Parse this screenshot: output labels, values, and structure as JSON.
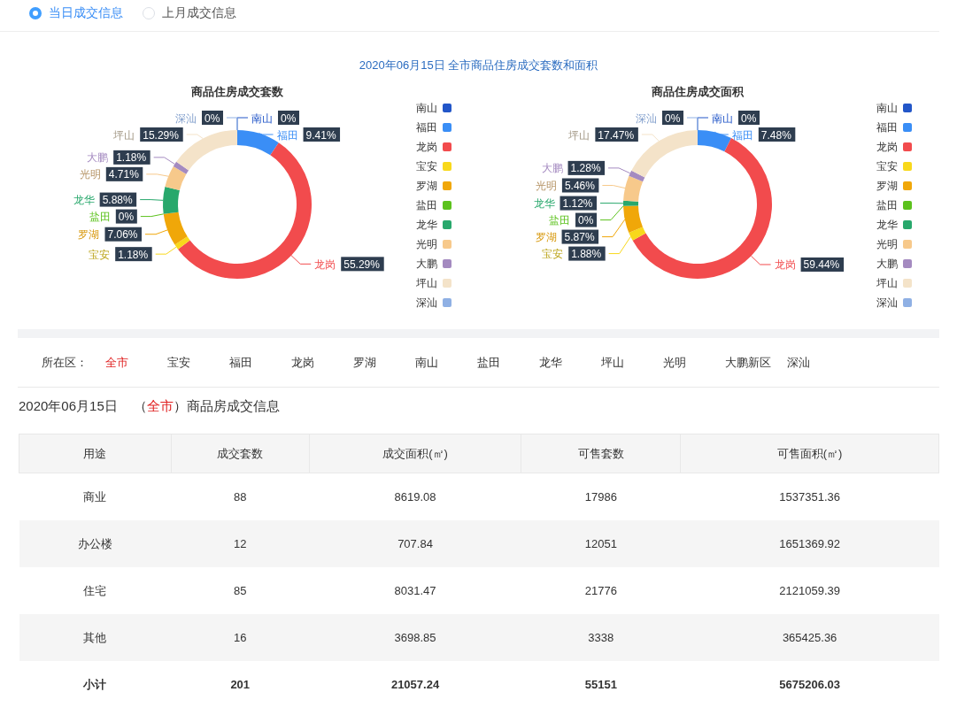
{
  "info_toggle": [
    {
      "label": "当日成交信息",
      "selected": true
    },
    {
      "label": "上月成交信息",
      "selected": false
    }
  ],
  "charts_title": "2020年06月15日 全市商品住房成交套数和面积",
  "charts": [
    {
      "chart_data": {
        "type": "donut",
        "legend": "right",
        "title": "商品住房成交套数",
        "categories": [
          "南山",
          "福田",
          "龙岗",
          "宝安",
          "罗湖",
          "盐田",
          "龙华",
          "光明",
          "大鹏",
          "坪山",
          "深汕"
        ],
        "colors": [
          "#2256c8",
          "#3a8ef6",
          "#f24b4d",
          "#f8d81b",
          "#f0a709",
          "#5cc21d",
          "#28a86c",
          "#f7c98b",
          "#a48ac0",
          "#f4e3c9",
          "#8fb0e4"
        ],
        "values": [
          0,
          9.41,
          55.29,
          1.18,
          7.06,
          0,
          5.88,
          4.71,
          1.18,
          15.29,
          0
        ],
        "value_labels": [
          "0%",
          "9.41%",
          "55.29%",
          "1.18%",
          "7.06%",
          "0%",
          "5.88%",
          "4.71%",
          "1.18%",
          "15.29%",
          "0%"
        ]
      }
    },
    {
      "chart_data": {
        "type": "donut",
        "legend": "right",
        "title": "商品住房成交面积",
        "categories": [
          "南山",
          "福田",
          "龙岗",
          "宝安",
          "罗湖",
          "盐田",
          "龙华",
          "光明",
          "大鹏",
          "坪山",
          "深汕"
        ],
        "colors": [
          "#2256c8",
          "#3a8ef6",
          "#f24b4d",
          "#f8d81b",
          "#f0a709",
          "#5cc21d",
          "#28a86c",
          "#f7c98b",
          "#a48ac0",
          "#f4e3c9",
          "#8fb0e4"
        ],
        "values": [
          0,
          7.48,
          59.44,
          1.88,
          5.87,
          0,
          1.12,
          5.46,
          1.28,
          17.47,
          0
        ],
        "value_labels": [
          "0%",
          "7.48%",
          "59.44%",
          "1.88%",
          "5.87%",
          "0%",
          "1.12%",
          "5.46%",
          "1.28%",
          "17.47%",
          "0%"
        ]
      }
    }
  ],
  "district_filter": {
    "label": "所在区：",
    "items": [
      {
        "label": "全市",
        "selected": true
      },
      {
        "label": "宝安",
        "selected": false
      },
      {
        "label": "福田",
        "selected": false
      },
      {
        "label": "龙岗",
        "selected": false
      },
      {
        "label": "罗湖",
        "selected": false
      },
      {
        "label": "南山",
        "selected": false
      },
      {
        "label": "盐田",
        "selected": false
      },
      {
        "label": "龙华",
        "selected": false
      },
      {
        "label": "坪山",
        "selected": false
      },
      {
        "label": "光明",
        "selected": false
      },
      {
        "label": "大鹏新区",
        "selected": false
      },
      {
        "label": "深汕",
        "selected": false
      }
    ]
  },
  "table_heading": {
    "date": "2020年06月15日",
    "open": "（",
    "district": "全市",
    "rest": "）商品房成交信息"
  },
  "table": {
    "columns": [
      "用途",
      "成交套数",
      "成交面积(㎡)",
      "可售套数",
      "可售面积(㎡)"
    ],
    "rows": [
      {
        "kind": "row",
        "cells": [
          "商业",
          "88",
          "8619.08",
          "17986",
          "1537351.36"
        ]
      },
      {
        "kind": "row",
        "cells": [
          "办公楼",
          "12",
          "707.84",
          "12051",
          "1651369.92"
        ]
      },
      {
        "kind": "row",
        "cells": [
          "住宅",
          "85",
          "8031.47",
          "21776",
          "2121059.39"
        ]
      },
      {
        "kind": "row",
        "cells": [
          "其他",
          "16",
          "3698.85",
          "3338",
          "365425.36"
        ]
      },
      {
        "kind": "total",
        "cells": [
          "小计",
          "201",
          "21057.24",
          "55151",
          "5675206.03"
        ]
      }
    ]
  }
}
